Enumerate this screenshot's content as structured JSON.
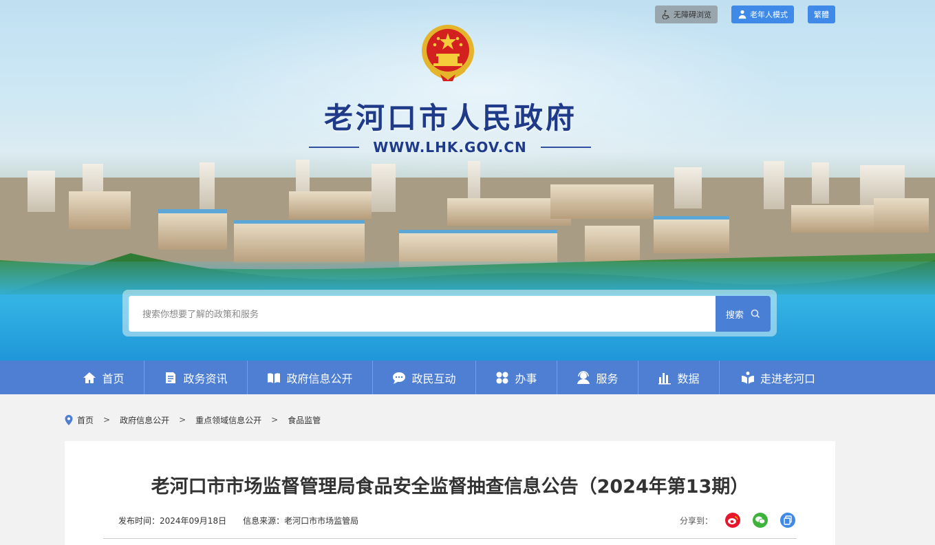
{
  "header": {
    "tools": [
      {
        "label": "无障碍浏览",
        "icon": "wheelchair-icon"
      },
      {
        "label": "老年人模式",
        "icon": "elder-icon"
      },
      {
        "label": "繁體"
      }
    ],
    "site_title": "老河口市人民政府",
    "site_url": "WWW.LHK.GOV.CN",
    "emblem": "national-emblem"
  },
  "search": {
    "placeholder": "搜索你想要了解的政策和服务",
    "button_label": "搜索"
  },
  "nav": {
    "items": [
      {
        "label": "首页",
        "icon": "home-icon"
      },
      {
        "label": "政务资讯",
        "icon": "news-icon"
      },
      {
        "label": "政府信息公开",
        "icon": "book-icon"
      },
      {
        "label": "政民互动",
        "icon": "chat-icon"
      },
      {
        "label": "办事",
        "icon": "grid-icon"
      },
      {
        "label": "服务",
        "icon": "user-service-icon"
      },
      {
        "label": "数据",
        "icon": "bar-chart-icon"
      },
      {
        "label": "走进老河口",
        "icon": "open-book-icon"
      }
    ]
  },
  "breadcrumb": {
    "items": [
      "首页",
      "政府信息公开",
      "重点领域信息公开",
      "食品监管"
    ],
    "separator": ">"
  },
  "article": {
    "title": "老河口市市场监督管理局食品安全监督抽查信息公告（2024年第13期）",
    "publish_time": "发布时间：2024年09月18日",
    "source": "信息来源：老河口市市场监管局",
    "share_label": "分享到：",
    "share_targets": [
      {
        "name": "weibo",
        "color": "#e6162d"
      },
      {
        "name": "wechat",
        "color": "#3db33b"
      },
      {
        "name": "copy",
        "color": "#3f8ae8"
      }
    ]
  },
  "colors": {
    "nav_bg": "#4e7fd3",
    "title_blue": "#1e3a88",
    "page_bg": "#f2f2f2"
  }
}
